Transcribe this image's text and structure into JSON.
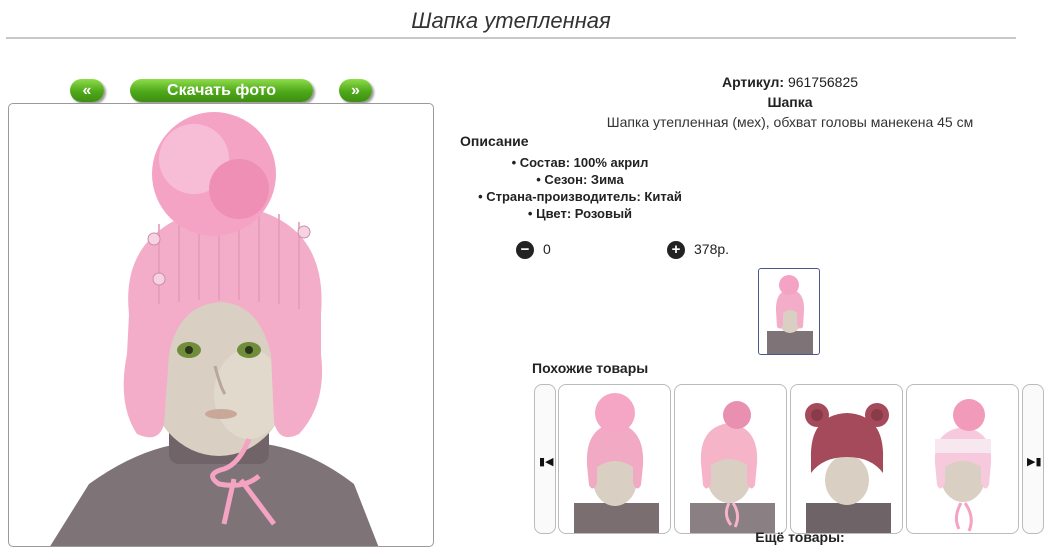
{
  "page": {
    "title": "Шапка утепленная"
  },
  "nav": {
    "prev_label": "«",
    "download_label": "Скачать фото",
    "next_label": "»"
  },
  "product": {
    "article_label": "Артикул:",
    "article_value": "961756825",
    "category": "Шапка",
    "description_line": "Шапка утепленная (мех), обхват головы манекена 45 см",
    "description_heading": "Описание",
    "attributes": [
      "• Состав: 100% акрил",
      "• Сезон: Зима",
      "• Страна-производитель: Китай",
      "• Цвет: Розовый"
    ]
  },
  "cart": {
    "quantity": "0",
    "price": "378р.",
    "minus_icon": "minus-circle-icon",
    "plus_icon": "plus-circle-icon"
  },
  "similar": {
    "heading": "Похожие товары",
    "prev_icon": "skip-back-icon",
    "next_icon": "skip-forward-icon",
    "items": [
      {
        "hat_color": "#f2a9c3",
        "pompom": "#f4a6c4"
      },
      {
        "hat_color": "#f5b4c8",
        "pompom": "#e98fb0"
      },
      {
        "hat_color": "#a44a5a",
        "pompom": ""
      },
      {
        "hat_color": "#f7c9dc",
        "pompom": "#f29ab9"
      }
    ]
  },
  "more": {
    "heading": "Ещё товары:"
  },
  "colors": {
    "accent_green": "#4ea81a",
    "hat_pink": "#f3a9c5"
  }
}
